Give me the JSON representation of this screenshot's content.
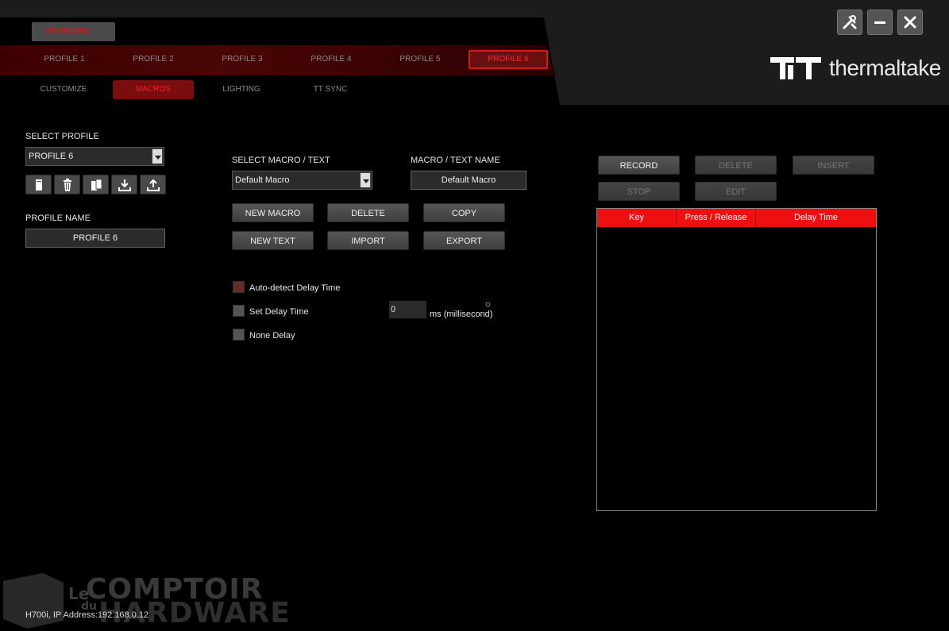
{
  "header": {
    "device_tab": "KEYBOARD",
    "profile_tabs": [
      "PROFILE 1",
      "PROFILE 2",
      "PROFILE 3",
      "PROFILE 4",
      "PROFILE 5",
      "PROFILE 6"
    ],
    "active_profile_tab": "PROFILE 6",
    "sub_tabs": [
      "CUSTOMIZE",
      "MACROS",
      "LIGHTING",
      "TT SYNC"
    ],
    "active_sub_tab": "MACROS",
    "brand": "thermaltake",
    "window_controls": [
      "tools-icon",
      "minimize-icon",
      "close-icon"
    ]
  },
  "profile": {
    "select_label": "SELECT PROFILE",
    "selected": "PROFILE 6",
    "actions": [
      "new-profile-icon",
      "delete-profile-icon",
      "copy-profile-icon",
      "import-profile-icon",
      "export-profile-icon"
    ],
    "name_label": "PROFILE NAME",
    "name_value": "PROFILE 6"
  },
  "macro": {
    "select_label": "SELECT MACRO / TEXT",
    "selected": "Default Macro",
    "name_label": "MACRO / TEXT NAME",
    "name_value": "Default Macro",
    "buttons": {
      "new_macro": "NEW MACRO",
      "delete": "DELETE",
      "copy": "COPY",
      "new_text": "NEW TEXT",
      "import": "IMPORT",
      "export": "EXPORT"
    },
    "delay_options": {
      "auto_detect": "Auto-detect Delay Time",
      "set_delay": "Set Delay Time",
      "none": "None Delay"
    },
    "delay_value": "0",
    "delay_unit": "ms (millisecond)"
  },
  "recorder": {
    "record": "RECORD",
    "delete": "DELETE",
    "insert": "INSERT",
    "stop": "STOP",
    "edit": "EDIT",
    "columns": [
      "Key",
      "Press / Release",
      "Delay Time"
    ]
  },
  "watermark": {
    "le": "Le",
    "du": "du",
    "comptoir": "COMPTOIR",
    "hardware": "HARDWARE"
  },
  "status_bar": "H700i, IP Address:192.168.0.12",
  "colors": {
    "accent": "#ee1010",
    "background": "#000000",
    "panel": "#1c1c1c"
  }
}
